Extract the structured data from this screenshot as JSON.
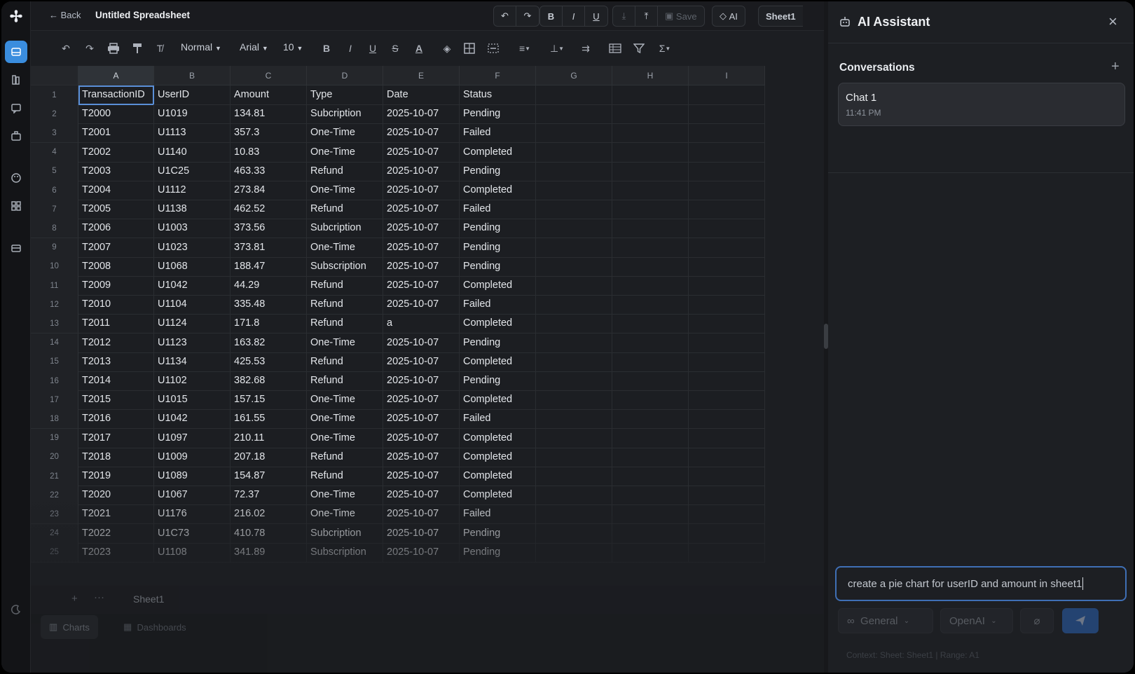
{
  "topbar": {
    "back_label": "Back",
    "doc_title": "Untitled Spreadsheet",
    "save_label": "Save",
    "ai_label": "AI",
    "sheet_label": "Sheet1"
  },
  "format_toolbar": {
    "style_select": "Normal",
    "font_select": "Arial",
    "size_select": "10"
  },
  "grid": {
    "columns": [
      "A",
      "B",
      "C",
      "D",
      "E",
      "F",
      "G",
      "H",
      "I"
    ],
    "selected_column": "A",
    "rows": [
      [
        "1",
        "TransactionID",
        "UserID",
        "Amount",
        "Type",
        "Date",
        "Status"
      ],
      [
        "2",
        "T2000",
        "U1019",
        "134.81",
        "Subcription",
        "2025-10-07",
        "Pending"
      ],
      [
        "3",
        "T2001",
        "U1113",
        "357.3",
        "One-Time",
        "2025-10-07",
        "Failed"
      ],
      [
        "4",
        "T2002",
        "U1140",
        "10.83",
        "One-Time",
        "2025-10-07",
        "Completed"
      ],
      [
        "5",
        "T2003",
        "U1C25",
        "463.33",
        "Refund",
        "2025-10-07",
        "Pending"
      ],
      [
        "6",
        "T2004",
        "U1112",
        "273.84",
        "One-Time",
        "2025-10-07",
        "Completed"
      ],
      [
        "7",
        "T2005",
        "U1138",
        "462.52",
        "Refund",
        "2025-10-07",
        "Failed"
      ],
      [
        "8",
        "T2006",
        "U1003",
        "373.56",
        "Subcription",
        "2025-10-07",
        "Pending"
      ],
      [
        "9",
        "T2007",
        "U1023",
        "373.81",
        "One-Time",
        "2025-10-07",
        "Pending"
      ],
      [
        "10",
        "T2008",
        "U1068",
        "188.47",
        "Subscription",
        "2025-10-07",
        "Pending"
      ],
      [
        "11",
        "T2009",
        "U1042",
        "44.29",
        "Refund",
        "2025-10-07",
        "Completed"
      ],
      [
        "12",
        "T2010",
        "U1104",
        "335.48",
        "Refund",
        "2025-10-07",
        "Failed"
      ],
      [
        "13",
        "T2011",
        "U1124",
        "171.8",
        "Refund",
        "a",
        "Completed"
      ],
      [
        "14",
        "T2012",
        "U1123",
        "163.82",
        "One-Time",
        "2025-10-07",
        "Pending"
      ],
      [
        "15",
        "T2013",
        "U1134",
        "425.53",
        "Refund",
        "2025-10-07",
        "Completed"
      ],
      [
        "16",
        "T2014",
        "U1102",
        "382.68",
        "Refund",
        "2025-10-07",
        "Pending"
      ],
      [
        "17",
        "T2015",
        "U1015",
        "157.15",
        "One-Time",
        "2025-10-07",
        "Completed"
      ],
      [
        "18",
        "T2016",
        "U1042",
        "161.55",
        "One-Time",
        "2025-10-07",
        "Failed"
      ],
      [
        "19",
        "T2017",
        "U1097",
        "210.11",
        "One-Time",
        "2025-10-07",
        "Completed"
      ],
      [
        "20",
        "T2018",
        "U1009",
        "207.18",
        "Refund",
        "2025-10-07",
        "Completed"
      ],
      [
        "21",
        "T2019",
        "U1089",
        "154.87",
        "Refund",
        "2025-10-07",
        "Completed"
      ],
      [
        "22",
        "T2020",
        "U1067",
        "72.37",
        "One-Time",
        "2025-10-07",
        "Completed"
      ],
      [
        "23",
        "T2021",
        "U1176",
        "216.02",
        "One-Time",
        "2025-10-07",
        "Failed"
      ],
      [
        "24",
        "T2022",
        "U1C73",
        "410.78",
        "Subcription",
        "2025-10-07",
        "Pending"
      ],
      [
        "25",
        "T2023",
        "U1108",
        "341.89",
        "Subscription",
        "2025-10-07",
        "Pending"
      ]
    ]
  },
  "sheet_tabs": {
    "tab_label": "Sheet1",
    "bottom_charts": "Charts",
    "bottom_dashboards": "Dashboards"
  },
  "ai_panel": {
    "title": "AI Assistant",
    "conversations_label": "Conversations",
    "chat_name": "Chat 1",
    "chat_time": "11:41 PM",
    "input_value": "create a pie chart for userID and amount in sheet1",
    "mode_select": "General",
    "model_select": "OpenAI",
    "context_text": "Context: Sheet: Sheet1 | Range: A1"
  },
  "colors": {
    "accent": "#3a8dde",
    "background": "#1c1e22",
    "panel": "#1d1f23",
    "input_border": "#3f6fb5"
  }
}
